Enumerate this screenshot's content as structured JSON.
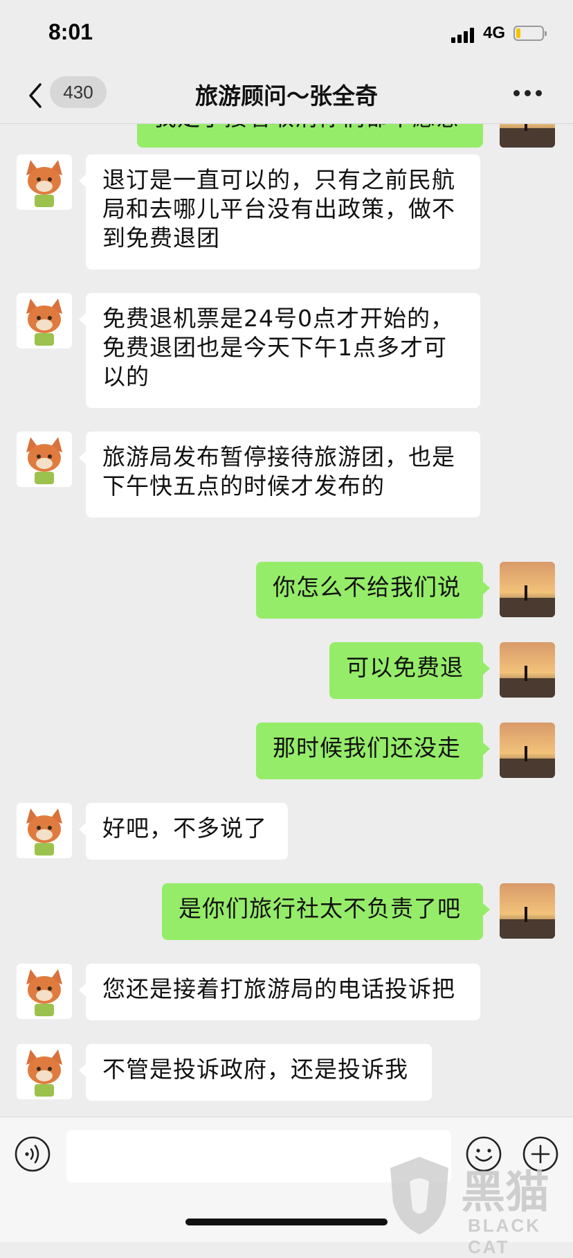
{
  "status_bar": {
    "time": "8:01",
    "network": "4G",
    "battery_color": "#f5c400"
  },
  "nav": {
    "unread_count": "430",
    "title": "旅游顾问～张全奇",
    "back_icon": "chevron-left-icon",
    "more_icon": "more-dots-icon"
  },
  "messages": [
    {
      "side": "out",
      "text": "我定了接着取消你们都不愿意"
    },
    {
      "side": "in",
      "text": "退订是一直可以的，只有之前民航局和去哪儿平台没有出政策，做不到免费退团"
    },
    {
      "side": "in",
      "text": "免费退机票是24号0点才开始的，免费退团也是今天下午1点多才可以的"
    },
    {
      "side": "in",
      "text": "旅游局发布暂停接待旅游团，也是下午快五点的时候才发布的"
    },
    {
      "side": "out",
      "text": "你怎么不给我们说"
    },
    {
      "side": "out",
      "text": "可以免费退"
    },
    {
      "side": "out",
      "text": "那时候我们还没走"
    },
    {
      "side": "in",
      "text": "好吧，不多说了"
    },
    {
      "side": "out",
      "text": "是你们旅行社太不负责了吧"
    },
    {
      "side": "in",
      "text": "您还是接着打旅游局的电话投诉把"
    },
    {
      "side": "in",
      "text": "不管是投诉政府，还是投诉我"
    }
  ],
  "input_bar": {
    "placeholder": "",
    "voice_icon": "voice-icon",
    "emoji_icon": "emoji-icon",
    "plus_icon": "plus-icon"
  },
  "colors": {
    "outgoing_bubble": "#95ec69",
    "incoming_bubble": "#ffffff",
    "background": "#ededed"
  },
  "watermark": {
    "text": "黑猫",
    "sub": "BLACK CAT"
  }
}
